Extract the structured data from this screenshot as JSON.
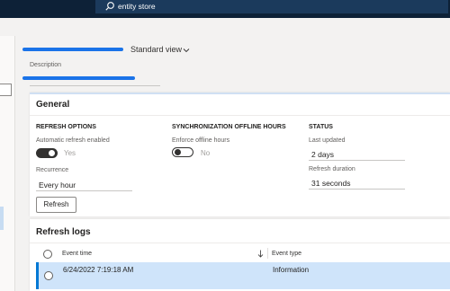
{
  "header": {
    "search_text": "entity store"
  },
  "page": {
    "view_selector": "Standard view"
  },
  "description": {
    "label": "Description"
  },
  "general": {
    "title": "General",
    "refresh_options": {
      "heading": "REFRESH OPTIONS",
      "auto_refresh_label": "Automatic refresh enabled",
      "auto_refresh_value": "Yes",
      "recurrence_label": "Recurrence",
      "recurrence_value": "Every hour",
      "refresh_button": "Refresh"
    },
    "sync": {
      "heading": "SYNCHRONIZATION OFFLINE HOURS",
      "enforce_label": "Enforce offline hours",
      "enforce_value": "No"
    },
    "status": {
      "heading": "STATUS",
      "last_updated_label": "Last updated",
      "last_updated_value": "2 days",
      "duration_label": "Refresh duration",
      "duration_value": "31 seconds"
    }
  },
  "logs": {
    "title": "Refresh logs",
    "columns": [
      "Event time",
      "Event type"
    ],
    "sort_icon": "sort-down-arrow-icon",
    "rows": [
      {
        "event_time": "6/24/2022 7:19:18 AM",
        "event_type": "Information"
      }
    ]
  },
  "colors": {
    "top_bar": "#0d2137",
    "accent": "#0078d4",
    "selected_row": "#cfe4fa"
  }
}
